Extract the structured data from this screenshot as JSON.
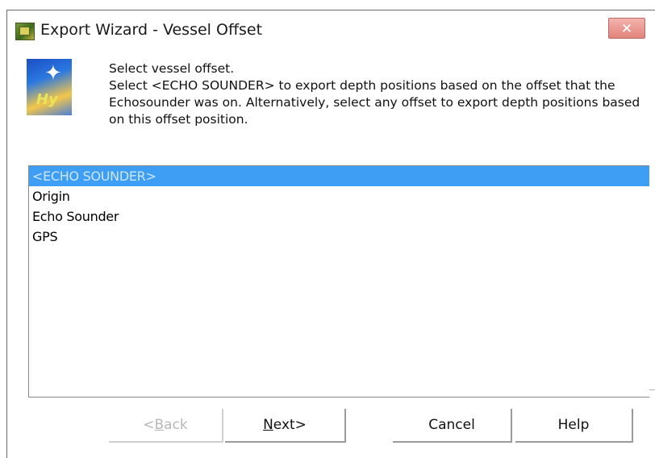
{
  "window": {
    "title": "Export Wizard - Vessel Offset",
    "close_label": "✕"
  },
  "header": {
    "line1": "Select vessel offset.",
    "line2": "Select <ECHO SOUNDER> to export depth positions based on the offset that the Echosounder was on. Alternatively, select any offset to export depth positions based on this offset position.",
    "logo_text": "Hy"
  },
  "offsets": {
    "items": [
      {
        "label": "<ECHO SOUNDER>",
        "selected": true
      },
      {
        "label": "Origin",
        "selected": false
      },
      {
        "label": "Echo Sounder",
        "selected": false
      },
      {
        "label": "GPS",
        "selected": false
      }
    ]
  },
  "buttons": {
    "back_prefix": "<",
    "back_mnemonic": "B",
    "back_rest": "ack",
    "next_mnemonic": "N",
    "next_rest": "ext>",
    "cancel": "Cancel",
    "help": "Help"
  },
  "colors": {
    "selection": "#3d9ef3",
    "close_button": "#e2847b"
  }
}
